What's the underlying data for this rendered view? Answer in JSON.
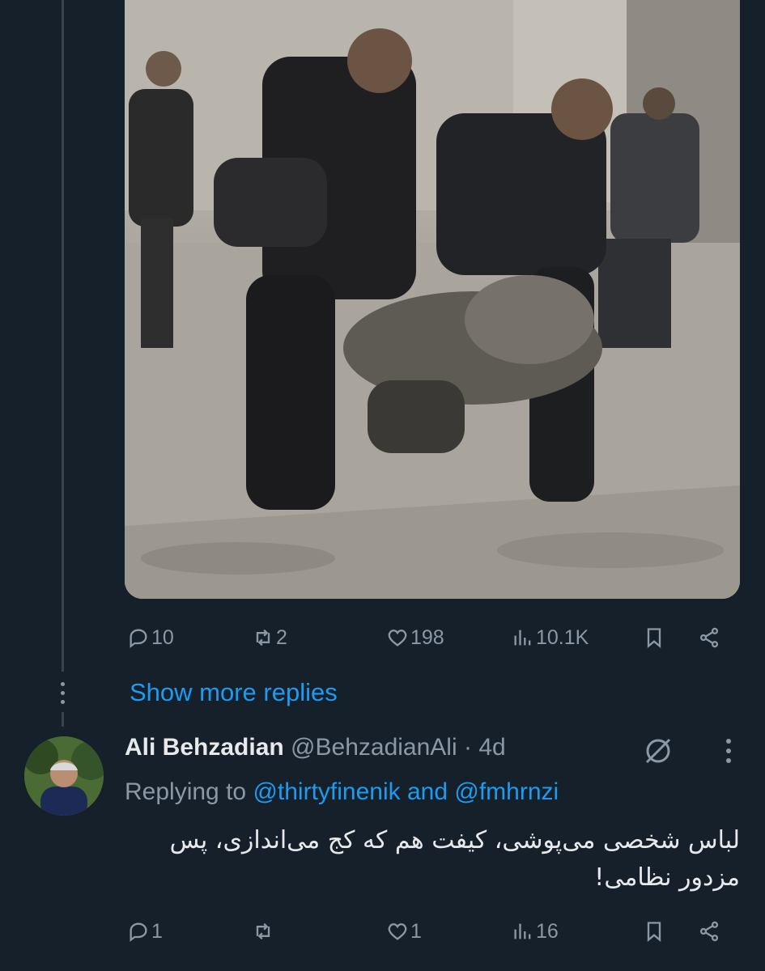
{
  "tweet1": {
    "actions": {
      "replies": "10",
      "retweets": "2",
      "likes": "198",
      "views": "10.1K"
    }
  },
  "show_more": "Show more replies",
  "tweet2": {
    "author_name": "Ali Behzadian",
    "author_handle": "@BehzadianAli",
    "separator": "·",
    "time": "4d",
    "replying_to_prefix": "Replying to",
    "mention_1": "@thirtyfinenik",
    "conjunction": "and",
    "mention_2": "@fmhrnzi",
    "text_line_1": "لباس شخصی می‌پوشی، کیفت هم که کج می‌اندازی، پس",
    "text_line_2": "مزدور نظامی!",
    "actions": {
      "replies": "1",
      "retweets": "",
      "likes": "1",
      "views": "16"
    }
  },
  "colors": {
    "background": "#15202b",
    "accent": "#1d9bf0",
    "muted": "#8b98a5",
    "text": "#e7e9ea"
  },
  "icons": [
    "reply-icon",
    "retweet-icon",
    "like-icon",
    "views-icon",
    "bookmark-icon",
    "share-icon",
    "grok-icon",
    "more-icon"
  ]
}
